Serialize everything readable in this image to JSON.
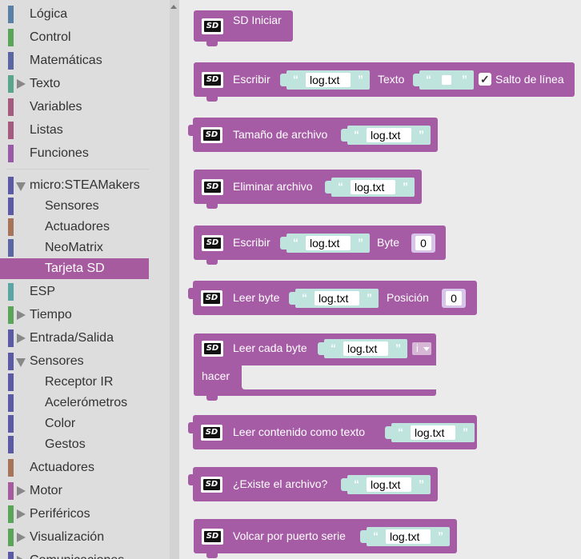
{
  "sidebar": {
    "categories": [
      {
        "label": "Lógica",
        "color": "#5b80a5"
      },
      {
        "label": "Control",
        "color": "#5ba55b"
      },
      {
        "label": "Matemáticas",
        "color": "#5b67a5"
      },
      {
        "label": "Texto",
        "color": "#5ba58c"
      },
      {
        "label": "Variables",
        "color": "#a55b80"
      },
      {
        "label": "Listas",
        "color": "#a55b80"
      },
      {
        "label": "Funciones",
        "color": "#995ba5"
      },
      {
        "label": "micro:STEAMakers",
        "color": "#5b5ba5"
      },
      {
        "label": "Sensores",
        "color": "#5b5ba5"
      },
      {
        "label": "Actuadores",
        "color": "#a5745b"
      },
      {
        "label": "NeoMatrix",
        "color": "#5b67a5"
      },
      {
        "label": "Tarjeta SD",
        "color": "#a55b9e"
      },
      {
        "label": "ESP",
        "color": "#5ba5a5"
      },
      {
        "label": "Tiempo",
        "color": "#5ba55b"
      },
      {
        "label": "Entrada/Salida",
        "color": "#5b5ba5"
      },
      {
        "label": "Sensores",
        "color": "#5b5ba5"
      },
      {
        "label": "Receptor IR",
        "color": "#5b5ba5"
      },
      {
        "label": "Acelerómetros",
        "color": "#5b5ba5"
      },
      {
        "label": "Color",
        "color": "#5b5ba5"
      },
      {
        "label": "Gestos",
        "color": "#5b5ba5"
      },
      {
        "label": "Actuadores",
        "color": "#a5745b"
      },
      {
        "label": "Motor",
        "color": "#a55b9e"
      },
      {
        "label": "Periféricos",
        "color": "#5ba55b"
      },
      {
        "label": "Visualización",
        "color": "#5ba55b"
      },
      {
        "label": "Comunicaciones",
        "color": "#5b5ba5"
      }
    ]
  },
  "blocks": {
    "sd_init": {
      "label": "SD Iniciar"
    },
    "write_text": {
      "label": "Escribir",
      "file": "log.txt",
      "text_label": "Texto",
      "text_value": "",
      "newline_label": "Salto de línea",
      "checkmark": "✓"
    },
    "file_size": {
      "label": "Tamaño de archivo",
      "file": "log.txt"
    },
    "delete_file": {
      "label": "Eliminar archivo",
      "file": "log.txt"
    },
    "write_byte": {
      "label": "Escribir",
      "file": "log.txt",
      "byte_label": "Byte",
      "byte_value": "0"
    },
    "read_byte": {
      "label": "Leer byte",
      "file": "log.txt",
      "pos_label": "Posición",
      "pos_value": "0"
    },
    "read_each_byte": {
      "label": "Leer cada byte",
      "file": "log.txt",
      "var": "i",
      "do_label": "hacer"
    },
    "read_text": {
      "label": "Leer contenido como texto",
      "file": "log.txt"
    },
    "file_exists": {
      "label": "¿Existe el archivo?",
      "file": "log.txt"
    },
    "dump_serial": {
      "label": "Volcar por puerto serie",
      "file": "log.txt"
    },
    "quote_open": "“",
    "quote_close": "”",
    "sd_icon_text": "SD"
  }
}
